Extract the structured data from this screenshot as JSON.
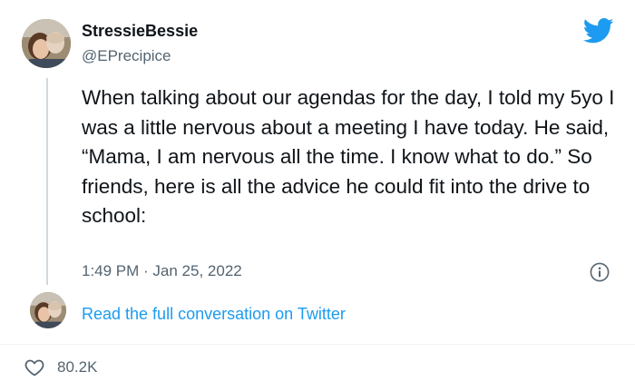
{
  "author": {
    "display_name": "StressieBessie",
    "handle": "@EPrecipice",
    "avatar": "avatar-photo"
  },
  "tweet": {
    "text": "When talking about our agendas for the day, I told my 5yo I was a little nervous about a meeting I have today. He said, “Mama, I am nervous all the time. I know what to do.” So friends, here is all the advice he could fit into the drive to school:",
    "timestamp": "1:49 PM · Jan 25, 2022"
  },
  "conversation_link": {
    "label": "Read the full conversation on Twitter"
  },
  "engagement": {
    "likes": "80.2K"
  },
  "icons": {
    "brand": "twitter-bird-icon",
    "info": "info-icon",
    "like": "heart-icon"
  },
  "colors": {
    "brand_blue": "#1d9bf0",
    "text_primary": "#0f1419",
    "text_secondary": "#536471",
    "thread_line": "#cfd9de"
  }
}
